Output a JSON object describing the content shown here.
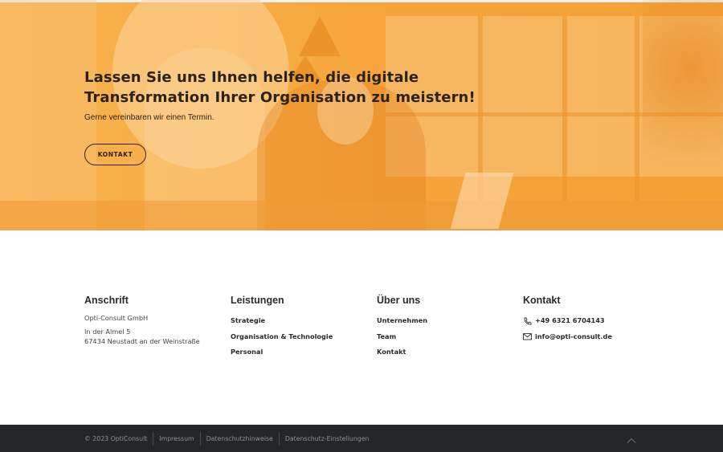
{
  "hero": {
    "title_line1": "Lassen Sie uns Ihnen helfen, die digitale",
    "title_line2": "Transformation Ihrer Organisation zu meistern!",
    "subtitle": "Gerne vereinbaren wir einen Termin.",
    "button_label": "KONTAKT",
    "overlay_color": "#f5a53c"
  },
  "footer": {
    "anschrift": {
      "heading": "Anschrift",
      "company": "Opti-Consult GmbH",
      "street": "In der Almel 5",
      "city": "67434 Neustadt an der Weinstraße"
    },
    "leistungen": {
      "heading": "Leistungen",
      "links": [
        "Strategie",
        "Organisation & Technologie",
        "Personal"
      ]
    },
    "ueber_uns": {
      "heading": "Über uns",
      "links": [
        "Unternehmen",
        "Team",
        "Kontakt"
      ]
    },
    "kontakt": {
      "heading": "Kontakt",
      "phone": "+49 6321 6704143",
      "email": "info@opti-consult.de",
      "phone_icon": "phone-icon",
      "email_icon": "mail-icon"
    }
  },
  "bottom_bar": {
    "copyright": "© 2023 OptiConsult",
    "links": [
      "Impressum",
      "Datenschutzhinweise",
      "Datenschutz-Einstellungen"
    ],
    "scroll_top_icon": "chevron-up-icon",
    "background": "#24262a"
  }
}
